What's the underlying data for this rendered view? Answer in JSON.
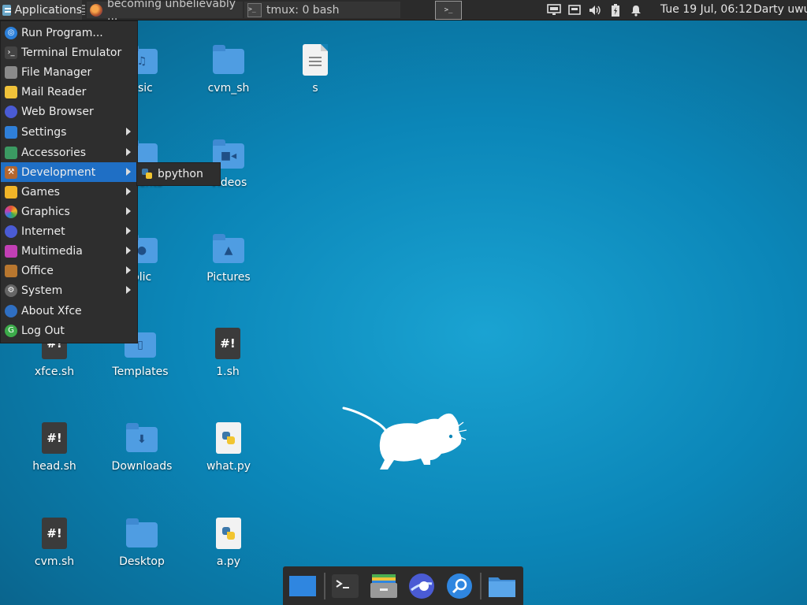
{
  "top_panel": {
    "applications_label": "Applications",
    "tasks": [
      {
        "label": "becoming unbelievably ...",
        "icon": "firefox-icon"
      },
      {
        "label": "tmux: 0 bash",
        "icon": "terminal-icon"
      }
    ],
    "terminal_button_glyph": ">_",
    "clock": "Tue 19 Jul, 06:12",
    "user": "Darty uwu"
  },
  "desktop": {
    "icons": [
      {
        "label": "usic",
        "type": "folder-music"
      },
      {
        "label": "cvm_sh",
        "type": "folder"
      },
      {
        "label": "s",
        "type": "text-file"
      },
      {
        "label": "uments",
        "type": "folder-documents"
      },
      {
        "label": "Videos",
        "type": "folder-videos"
      },
      {
        "label": "blic",
        "type": "folder-public"
      },
      {
        "label": "Pictures",
        "type": "folder-pictures"
      },
      {
        "label": "xfce.sh",
        "type": "script"
      },
      {
        "label": "Templates",
        "type": "folder-templates"
      },
      {
        "label": "1.sh",
        "type": "script"
      },
      {
        "label": "head.sh",
        "type": "script"
      },
      {
        "label": "Downloads",
        "type": "folder-downloads"
      },
      {
        "label": "what.py",
        "type": "python-file"
      },
      {
        "label": "cvm.sh",
        "type": "script"
      },
      {
        "label": "Desktop",
        "type": "folder"
      },
      {
        "label": "a.py",
        "type": "python-file"
      }
    ],
    "script_glyph": "#!"
  },
  "menu": {
    "items": [
      {
        "label": "Run Program...",
        "icon": "run-icon",
        "color": "#2b7fd9",
        "submenu": false
      },
      {
        "label": "Terminal Emulator",
        "icon": "terminal-icon",
        "color": "#444444",
        "submenu": false
      },
      {
        "label": "File Manager",
        "icon": "file-manager-icon",
        "color": "#8a8a8a",
        "submenu": false
      },
      {
        "label": "Mail Reader",
        "icon": "mail-icon",
        "color": "#f0c23a",
        "submenu": false
      },
      {
        "label": "Web Browser",
        "icon": "web-browser-icon",
        "color": "#4a5bd4",
        "submenu": false
      },
      {
        "label": "Settings",
        "icon": "settings-icon",
        "color": "#2f7fd8",
        "submenu": true
      },
      {
        "label": "Accessories",
        "icon": "accessories-icon",
        "color": "#3b9a62",
        "submenu": true
      },
      {
        "label": "Development",
        "icon": "development-icon",
        "color": "#b3662e",
        "submenu": true
      },
      {
        "label": "Games",
        "icon": "games-icon",
        "color": "#f0b428",
        "submenu": true
      },
      {
        "label": "Graphics",
        "icon": "graphics-icon",
        "color": "#e0503a",
        "submenu": true
      },
      {
        "label": "Internet",
        "icon": "internet-icon",
        "color": "#4a5bd4",
        "submenu": true
      },
      {
        "label": "Multimedia",
        "icon": "multimedia-icon",
        "color": "#c23fb5",
        "submenu": true
      },
      {
        "label": "Office",
        "icon": "office-icon",
        "color": "#b8772f",
        "submenu": true
      },
      {
        "label": "System",
        "icon": "system-icon",
        "color": "#666666",
        "submenu": true
      },
      {
        "label": "About Xfce",
        "icon": "about-xfce-icon",
        "color": "#2f6fc2",
        "submenu": false
      },
      {
        "label": "Log Out",
        "icon": "logout-icon",
        "color": "#3cab4a",
        "submenu": false
      }
    ],
    "active_item": "Development",
    "submenu_items": [
      {
        "label": "bpython",
        "icon": "python-icon"
      }
    ]
  },
  "dock": {
    "items": [
      {
        "name": "show-desktop",
        "icon": "show-desktop-icon"
      },
      {
        "name": "terminal",
        "icon": "terminal-icon"
      },
      {
        "name": "file-manager",
        "icon": "file-manager-icon"
      },
      {
        "name": "web-browser",
        "icon": "web-browser-icon"
      },
      {
        "name": "app-finder",
        "icon": "search-icon"
      },
      {
        "name": "home-folder",
        "icon": "folder-icon"
      }
    ]
  },
  "colors": {
    "accent": "#1f6fc5",
    "panel": "#2b2b2b",
    "desktop": "#0b86b8"
  }
}
